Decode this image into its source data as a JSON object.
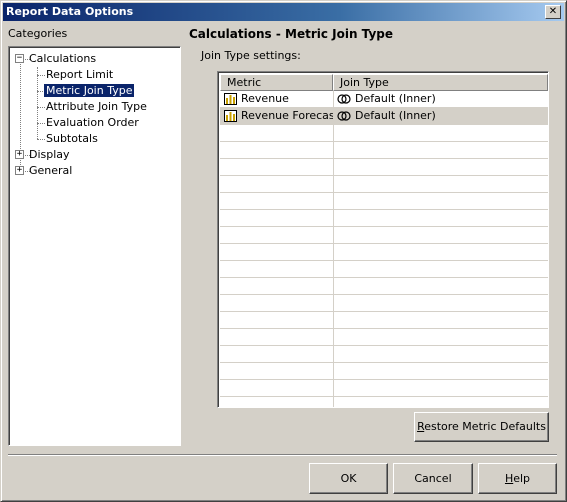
{
  "window": {
    "title": "Report Data Options",
    "close_glyph": "✕"
  },
  "categories": {
    "label": "Categories",
    "tree": [
      {
        "label": "Calculations",
        "expanded": true,
        "toggle": "−",
        "children": [
          "Report Limit",
          "Metric Join Type",
          "Attribute Join Type",
          "Evaluation Order",
          "Subtotals"
        ]
      },
      {
        "label": "Display",
        "expanded": false,
        "toggle": "+"
      },
      {
        "label": "General",
        "expanded": false,
        "toggle": "+"
      }
    ],
    "selected": "Metric Join Type"
  },
  "main": {
    "title": "Calculations - Metric Join Type",
    "settings_label": "Join Type settings:",
    "grid": {
      "columns": [
        "Metric",
        "Join Type"
      ],
      "rows": [
        {
          "metric": "Revenue",
          "join_type": "Default (Inner)",
          "metric_icon": "metric-icon",
          "join_icon": "join-icon"
        },
        {
          "metric": "Revenue Forecast",
          "join_type": "Default (Inner)",
          "metric_icon": "metric-icon",
          "join_icon": "join-icon"
        }
      ]
    },
    "restore_button": {
      "accel": "R",
      "rest": "estore Metric Defaults"
    }
  },
  "footer": {
    "ok": "OK",
    "cancel": "Cancel",
    "help": {
      "accel": "H",
      "rest": "elp"
    }
  },
  "colors": {
    "face": "#d4d0c8",
    "title_start": "#0a246a",
    "title_end": "#a6caf0",
    "selection": "#0a246a"
  }
}
